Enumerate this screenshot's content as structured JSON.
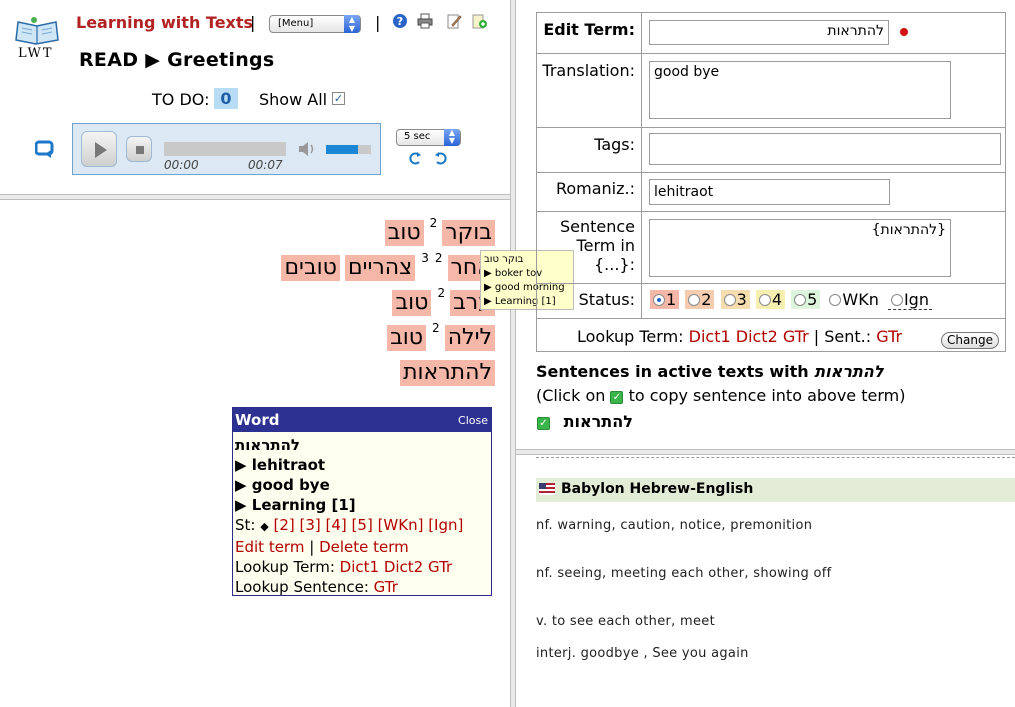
{
  "header": {
    "logo_text": "LWT",
    "app_title": "Learning with Texts",
    "separator": "|",
    "menu_label": "[Menu]",
    "read_label": "READ",
    "read_arrow": "▶",
    "text_title": "Greetings",
    "todo_label": "TO DO:",
    "todo_count": "0",
    "show_all_label": "Show All",
    "icons": [
      "help-icon",
      "print-icon",
      "edit-icon",
      "new-text-icon"
    ]
  },
  "player": {
    "time_current": "00:00",
    "time_total": "00:07",
    "volume": 0.7,
    "progress": 0,
    "seconds_option": "5 sec"
  },
  "text": {
    "lines": [
      {
        "words": [
          "בוקר",
          "טוב"
        ],
        "sup": "2"
      },
      {
        "words": [
          "אחר",
          "צהריים",
          "טובים"
        ],
        "sup": "2",
        "sup2": "3"
      },
      {
        "words": [
          "ערב",
          "טוב"
        ],
        "sup": "2"
      },
      {
        "words": [
          "לילה",
          "טוב"
        ],
        "sup": "2"
      },
      {
        "words": [
          "להתראות"
        ],
        "sup": ""
      }
    ]
  },
  "tooltip": {
    "title": "בוקר טוב",
    "lines": [
      "▶ boker tov",
      "▶ good morning",
      "▶ Learning [1]"
    ]
  },
  "word_popup": {
    "header": "Word",
    "close": "Close",
    "term": "להתראות",
    "romanization": "▶ lehitraot",
    "translation": "▶ good bye",
    "status": "▶ Learning [1]",
    "st_label": "St:",
    "st_diamond": "◆",
    "st_links": "[2] [3] [4] [5] [WKn] [Ign]",
    "edit_term": "Edit term",
    "pipe": "|",
    "delete_term": "Delete term",
    "lookup_term_label": "Lookup Term:",
    "lookup_term_links": "Dict1 Dict2 GTr",
    "lookup_sentence_label": "Lookup Sentence:",
    "lookup_sentence_link": "GTr"
  },
  "form": {
    "edit_term_label": "Edit Term:",
    "edit_term_value": "להתראות",
    "translation_label": "Translation:",
    "translation_value": "good bye",
    "tags_label": "Tags:",
    "romaniz_label": "Romaniz.:",
    "romaniz_value": "lehitraot",
    "sentence_label_1": "Sentence",
    "sentence_label_2": "Term in",
    "sentence_label_3": "{...}:",
    "sentence_value": "{להתראות}",
    "status_label": "Status:",
    "status_options": [
      {
        "label": "1",
        "bg": "#f5b8a8",
        "checked": true
      },
      {
        "label": "2",
        "bg": "#f5ccb0",
        "checked": false
      },
      {
        "label": "3",
        "bg": "#f5ddb0",
        "checked": false
      },
      {
        "label": "4",
        "bg": "#f5f0b0",
        "checked": false
      },
      {
        "label": "5",
        "bg": "#ddf5dd",
        "checked": false
      },
      {
        "label": "WKn",
        "bg": "#ffffff",
        "checked": false
      },
      {
        "label": "Ign",
        "bg": "#ffffff",
        "checked": false
      }
    ],
    "lookup_term_label": "Lookup Term:",
    "lookup_term_links": "Dict1 Dict2 GTr",
    "pipe": "|",
    "sent_label": "Sent.:",
    "sent_link": "GTr",
    "change_button": "Change"
  },
  "sentences": {
    "heading_prefix": "Sentences in active texts with",
    "heading_term": "להתראות",
    "note_prefix": "(Click on",
    "note_suffix": "to copy sentence into above term)",
    "item": "להתראות"
  },
  "dictionary": {
    "name": "Babylon Hebrew-English",
    "entries": [
      "nf. warning, caution, notice, premonition",
      "nf. seeing, meeting each other, showing off",
      "v. to see each other, meet",
      "interj. goodbye , See you again"
    ]
  },
  "colors": {
    "brand_red": "#b22222",
    "status1": "#f5b8a8",
    "popup_header": "#2d3192",
    "link_red": "#b30000"
  }
}
